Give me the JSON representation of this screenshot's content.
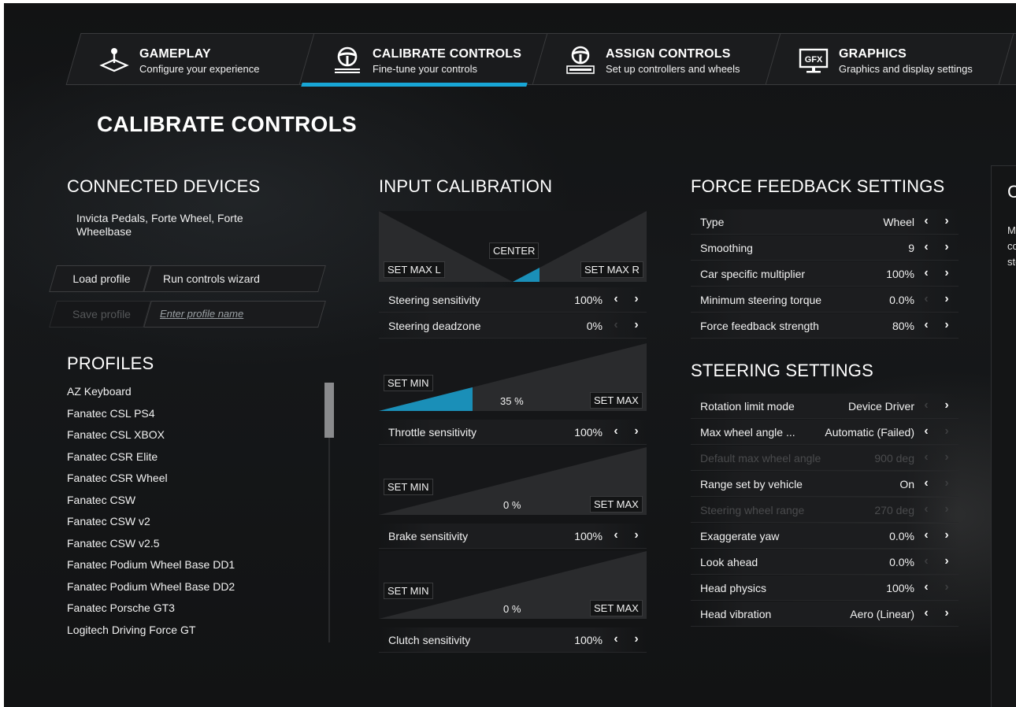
{
  "tabs": [
    {
      "title": "GAMEPLAY",
      "subtitle": "Configure your experience",
      "icon": "joystick-icon",
      "active": false
    },
    {
      "title": "CALIBRATE CONTROLS",
      "subtitle": "Fine-tune your controls",
      "icon": "steering-wheel-icon",
      "active": true
    },
    {
      "title": "ASSIGN CONTROLS",
      "subtitle": "Set up controllers and wheels",
      "icon": "wheel-keyboard-icon",
      "active": false
    },
    {
      "title": "GRAPHICS",
      "subtitle": "Graphics and display settings",
      "icon": "gfx-monitor-icon",
      "active": false
    }
  ],
  "accent_color": "#18a6d6",
  "page_title": "CALIBRATE CONTROLS",
  "connected_devices": {
    "title": "CONNECTED DEVICES",
    "devices": "Invicta Pedals, Forte Wheel, Forte Wheelbase",
    "load_profile": "Load profile",
    "run_wizard": "Run controls wizard",
    "save_profile": "Save profile",
    "profile_name_placeholder": "Enter profile name"
  },
  "profiles": {
    "title": "PROFILES",
    "items": [
      "AZ Keyboard",
      "Fanatec CSL PS4",
      "Fanatec CSL XBOX",
      "Fanatec CSR Elite",
      "Fanatec CSR Wheel",
      "Fanatec CSW",
      "Fanatec CSW v2",
      "Fanatec CSW v2.5",
      "Fanatec Podium Wheel Base DD1",
      "Fanatec Podium Wheel Base DD2",
      "Fanatec Porsche GT3",
      "Logitech Driving Force GT"
    ]
  },
  "input_calibration": {
    "title": "INPUT CALIBRATION",
    "steering": {
      "set_max_l": "SET MAX L",
      "center": "CENTER",
      "set_max_r": "SET MAX R",
      "fill_fraction": 0.2
    },
    "steering_rows": [
      {
        "label": "Steering sensitivity",
        "value": "100%",
        "left_enabled": true,
        "right_enabled": true
      },
      {
        "label": "Steering deadzone",
        "value": "0%",
        "left_enabled": false,
        "right_enabled": true
      }
    ],
    "pedals": [
      {
        "set_min": "SET MIN",
        "set_max": "SET MAX",
        "percent": "35 %",
        "fill_fraction": 0.35,
        "row": {
          "label": "Throttle sensitivity",
          "value": "100%",
          "left_enabled": true,
          "right_enabled": true
        }
      },
      {
        "set_min": "SET MIN",
        "set_max": "SET MAX",
        "percent": "0 %",
        "fill_fraction": 0.0,
        "row": {
          "label": "Brake sensitivity",
          "value": "100%",
          "left_enabled": true,
          "right_enabled": true
        }
      },
      {
        "set_min": "SET MIN",
        "set_max": "SET MAX",
        "percent": "0 %",
        "fill_fraction": 0.0,
        "row": {
          "label": "Clutch sensitivity",
          "value": "100%",
          "left_enabled": true,
          "right_enabled": true
        }
      }
    ]
  },
  "force_feedback": {
    "title": "FORCE FEEDBACK SETTINGS",
    "rows": [
      {
        "label": "Type",
        "value": "Wheel",
        "left_enabled": true,
        "right_enabled": true,
        "disabled": false
      },
      {
        "label": "Smoothing",
        "value": "9",
        "left_enabled": true,
        "right_enabled": true,
        "disabled": false
      },
      {
        "label": "Car specific multiplier",
        "value": "100%",
        "left_enabled": true,
        "right_enabled": true,
        "disabled": false
      },
      {
        "label": "Minimum steering torque",
        "value": "0.0%",
        "left_enabled": false,
        "right_enabled": true,
        "disabled": false
      },
      {
        "label": "Force feedback strength",
        "value": "80%",
        "left_enabled": true,
        "right_enabled": true,
        "disabled": false
      }
    ]
  },
  "steering_settings": {
    "title": "STEERING SETTINGS",
    "rows": [
      {
        "label": "Rotation limit mode",
        "value": "Device Driver",
        "left_enabled": false,
        "right_enabled": true,
        "disabled": false
      },
      {
        "label": "Max wheel angle ...",
        "value": "Automatic (Failed)",
        "left_enabled": true,
        "right_enabled": false,
        "disabled": false
      },
      {
        "label": "Default max wheel angle",
        "value": "900 deg",
        "left_enabled": false,
        "right_enabled": false,
        "disabled": true
      },
      {
        "label": "Range set by vehicle",
        "value": "On",
        "left_enabled": true,
        "right_enabled": false,
        "disabled": false
      },
      {
        "label": "Steering wheel range",
        "value": "270 deg",
        "left_enabled": false,
        "right_enabled": false,
        "disabled": true
      },
      {
        "label": "Exaggerate yaw",
        "value": "0.0%",
        "left_enabled": true,
        "right_enabled": true,
        "disabled": false
      },
      {
        "label": "Look ahead",
        "value": "0.0%",
        "left_enabled": false,
        "right_enabled": true,
        "disabled": false
      },
      {
        "label": "Head physics",
        "value": "100%",
        "left_enabled": true,
        "right_enabled": false,
        "disabled": false
      },
      {
        "label": "Head vibration",
        "value": "Aero (Linear)",
        "left_enabled": true,
        "right_enabled": true,
        "disabled": false
      }
    ]
  },
  "side_panel": {
    "title": "C",
    "text_lines": [
      "Ma",
      "co",
      "ste"
    ]
  },
  "arrows": {
    "left": "‹",
    "right": "›"
  }
}
